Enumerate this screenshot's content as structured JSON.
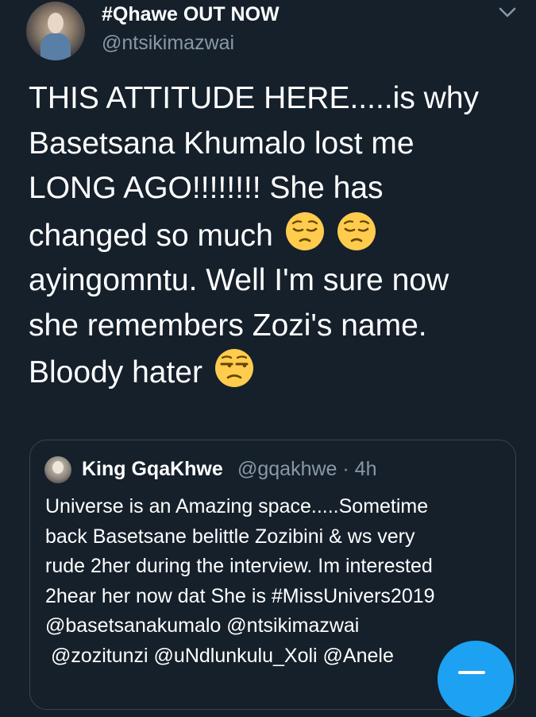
{
  "tweet": {
    "display_name": "#Qhawe OUT NOW",
    "handle": "@ntsikimazwai",
    "text_lines": [
      "THIS ATTITUDE HERE.....is why",
      "Basetsana Khumalo lost me",
      "LONG AGO!!!!!!!! She has",
      "changed so much",
      "ayingomntu. Well I'm sure now",
      "she remembers Zozi's name.",
      "Bloody hater"
    ],
    "emoji": [
      "pensive-face",
      "pensive-face",
      "unamused-face"
    ]
  },
  "quoted_tweet": {
    "name": "King GqaKhwe",
    "handle_time": "@gqakhwe · 4h",
    "text_lines": [
      "Universe is an Amazing space.....Sometime",
      "back Basetsane belittle Zozibini & ws very",
      "rude 2her during the interview. Im interested",
      "2hear her now dat She is #MissUnivers2019",
      "@basetsanakumalo @ntsikimazwai",
      " @zozitunzi @uNdlunkulu_Xoli @Anele"
    ]
  },
  "icons": {
    "menu": "chevron-down-icon",
    "compose": "compose-fab"
  },
  "colors": {
    "background": "#15202b",
    "secondary_text": "#8899a6",
    "accent": "#1da1f2",
    "border": "#38444d",
    "emoji_yellow": "#ffcc4d"
  }
}
